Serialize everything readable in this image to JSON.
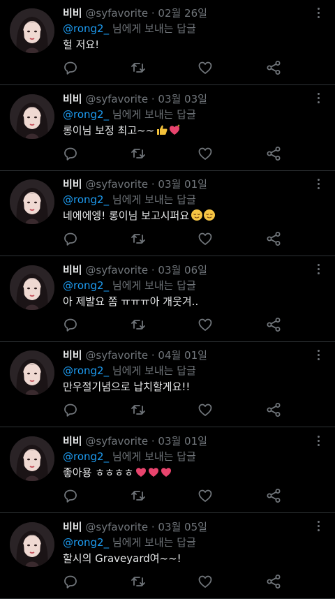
{
  "tweets": [
    {
      "display_name": "비비",
      "handle": "@syfavorite",
      "separator": "·",
      "date": "02월 26일",
      "mention": "@rong2_",
      "reply_suffix": "님에게 보내는 답글",
      "text": "헐 저요!",
      "emojis": []
    },
    {
      "display_name": "비비",
      "handle": "@syfavorite",
      "separator": "·",
      "date": "03월 03일",
      "mention": "@rong2_",
      "reply_suffix": "님에게 보내는 답글",
      "text": "롱이님 보정 최고~~",
      "emojis": [
        "thumbs-up-emoji",
        "sparkling-heart-emoji"
      ]
    },
    {
      "display_name": "비비",
      "handle": "@syfavorite",
      "separator": "·",
      "date": "03월 01일",
      "mention": "@rong2_",
      "reply_suffix": "님에게 보내는 답글",
      "text": "네에에엥! 롱이님 보고시퍼요",
      "emojis": [
        "relieved-face-emoji",
        "relieved-face-emoji"
      ]
    },
    {
      "display_name": "비비",
      "handle": "@syfavorite",
      "separator": "·",
      "date": "03월 06일",
      "mention": "@rong2_",
      "reply_suffix": "님에게 보내는 답글",
      "text": "아 제발요 쫌 ㅠㅠㅠ아 개웃겨..",
      "emojis": []
    },
    {
      "display_name": "비비",
      "handle": "@syfavorite",
      "separator": "·",
      "date": "04월 01일",
      "mention": "@rong2_",
      "reply_suffix": "님에게 보내는 답글",
      "text": "만우절기념으로 납치할게요!!",
      "emojis": []
    },
    {
      "display_name": "비비",
      "handle": "@syfavorite",
      "separator": "·",
      "date": "03월 01일",
      "mention": "@rong2_",
      "reply_suffix": "님에게 보내는 답글",
      "text": "좋아용 ㅎㅎㅎㅎ",
      "emojis": [
        "heart-emoji",
        "heart-emoji",
        "heart-emoji"
      ]
    },
    {
      "display_name": "비비",
      "handle": "@syfavorite",
      "separator": "·",
      "date": "03월 05일",
      "mention": "@rong2_",
      "reply_suffix": "님에게 보내는 답글",
      "text": "할시의 Graveyard여~~!",
      "emojis": []
    }
  ],
  "icons": {
    "reply": "reply-icon",
    "retweet": "retweet-icon",
    "like": "like-icon",
    "share": "share-icon",
    "more": "more-options-icon"
  },
  "colors": {
    "background": "#000000",
    "text": "#e7e9ea",
    "muted": "#71767b",
    "mention": "#1d9bf0",
    "divider": "#2f3336"
  }
}
